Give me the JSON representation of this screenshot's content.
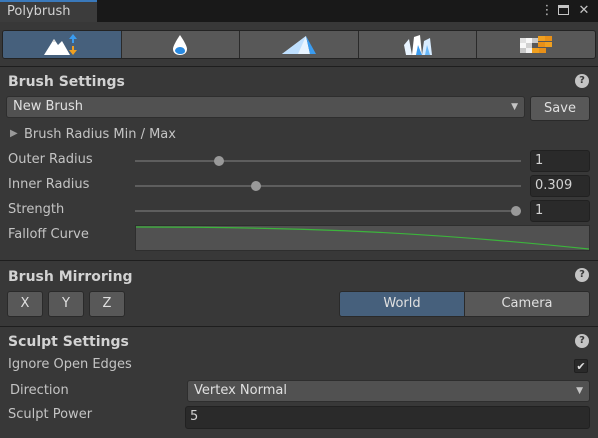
{
  "window": {
    "title": "Polybrush"
  },
  "toolbar": {
    "tools": [
      {
        "name": "sculpt-mode",
        "icon": "mountain-raise-icon"
      },
      {
        "name": "smooth-mode",
        "icon": "water-drop-icon"
      },
      {
        "name": "paint-mode",
        "icon": "paint-prism-icon"
      },
      {
        "name": "prefab-mode",
        "icon": "crystals-icon"
      },
      {
        "name": "texture-mode",
        "icon": "texture-blocks-icon"
      }
    ],
    "active_index": 0
  },
  "brush_settings": {
    "title": "Brush Settings",
    "preset": "New Brush",
    "save_label": "Save",
    "radius_foldout": "Brush Radius Min / Max",
    "outer_radius": {
      "label": "Outer Radius",
      "value": "1",
      "fraction": 0.21
    },
    "inner_radius": {
      "label": "Inner Radius",
      "value": "0.309",
      "fraction": 0.309
    },
    "strength": {
      "label": "Strength",
      "value": "1",
      "fraction": 1.0
    },
    "falloff_label": "Falloff Curve"
  },
  "mirroring": {
    "title": "Brush Mirroring",
    "axes": [
      "X",
      "Y",
      "Z"
    ],
    "space_options": [
      "World",
      "Camera"
    ],
    "selected_space": "World"
  },
  "sculpt": {
    "title": "Sculpt Settings",
    "ignore_open_edges_label": "Ignore Open Edges",
    "ignore_open_edges": true,
    "direction_label": "Direction",
    "direction_value": "Vertex Normal",
    "power_label": "Sculpt Power",
    "power_value": "5"
  },
  "colors": {
    "accent": "#3a79bb",
    "active_tool": "#46607c",
    "curve": "#3cb43c"
  }
}
